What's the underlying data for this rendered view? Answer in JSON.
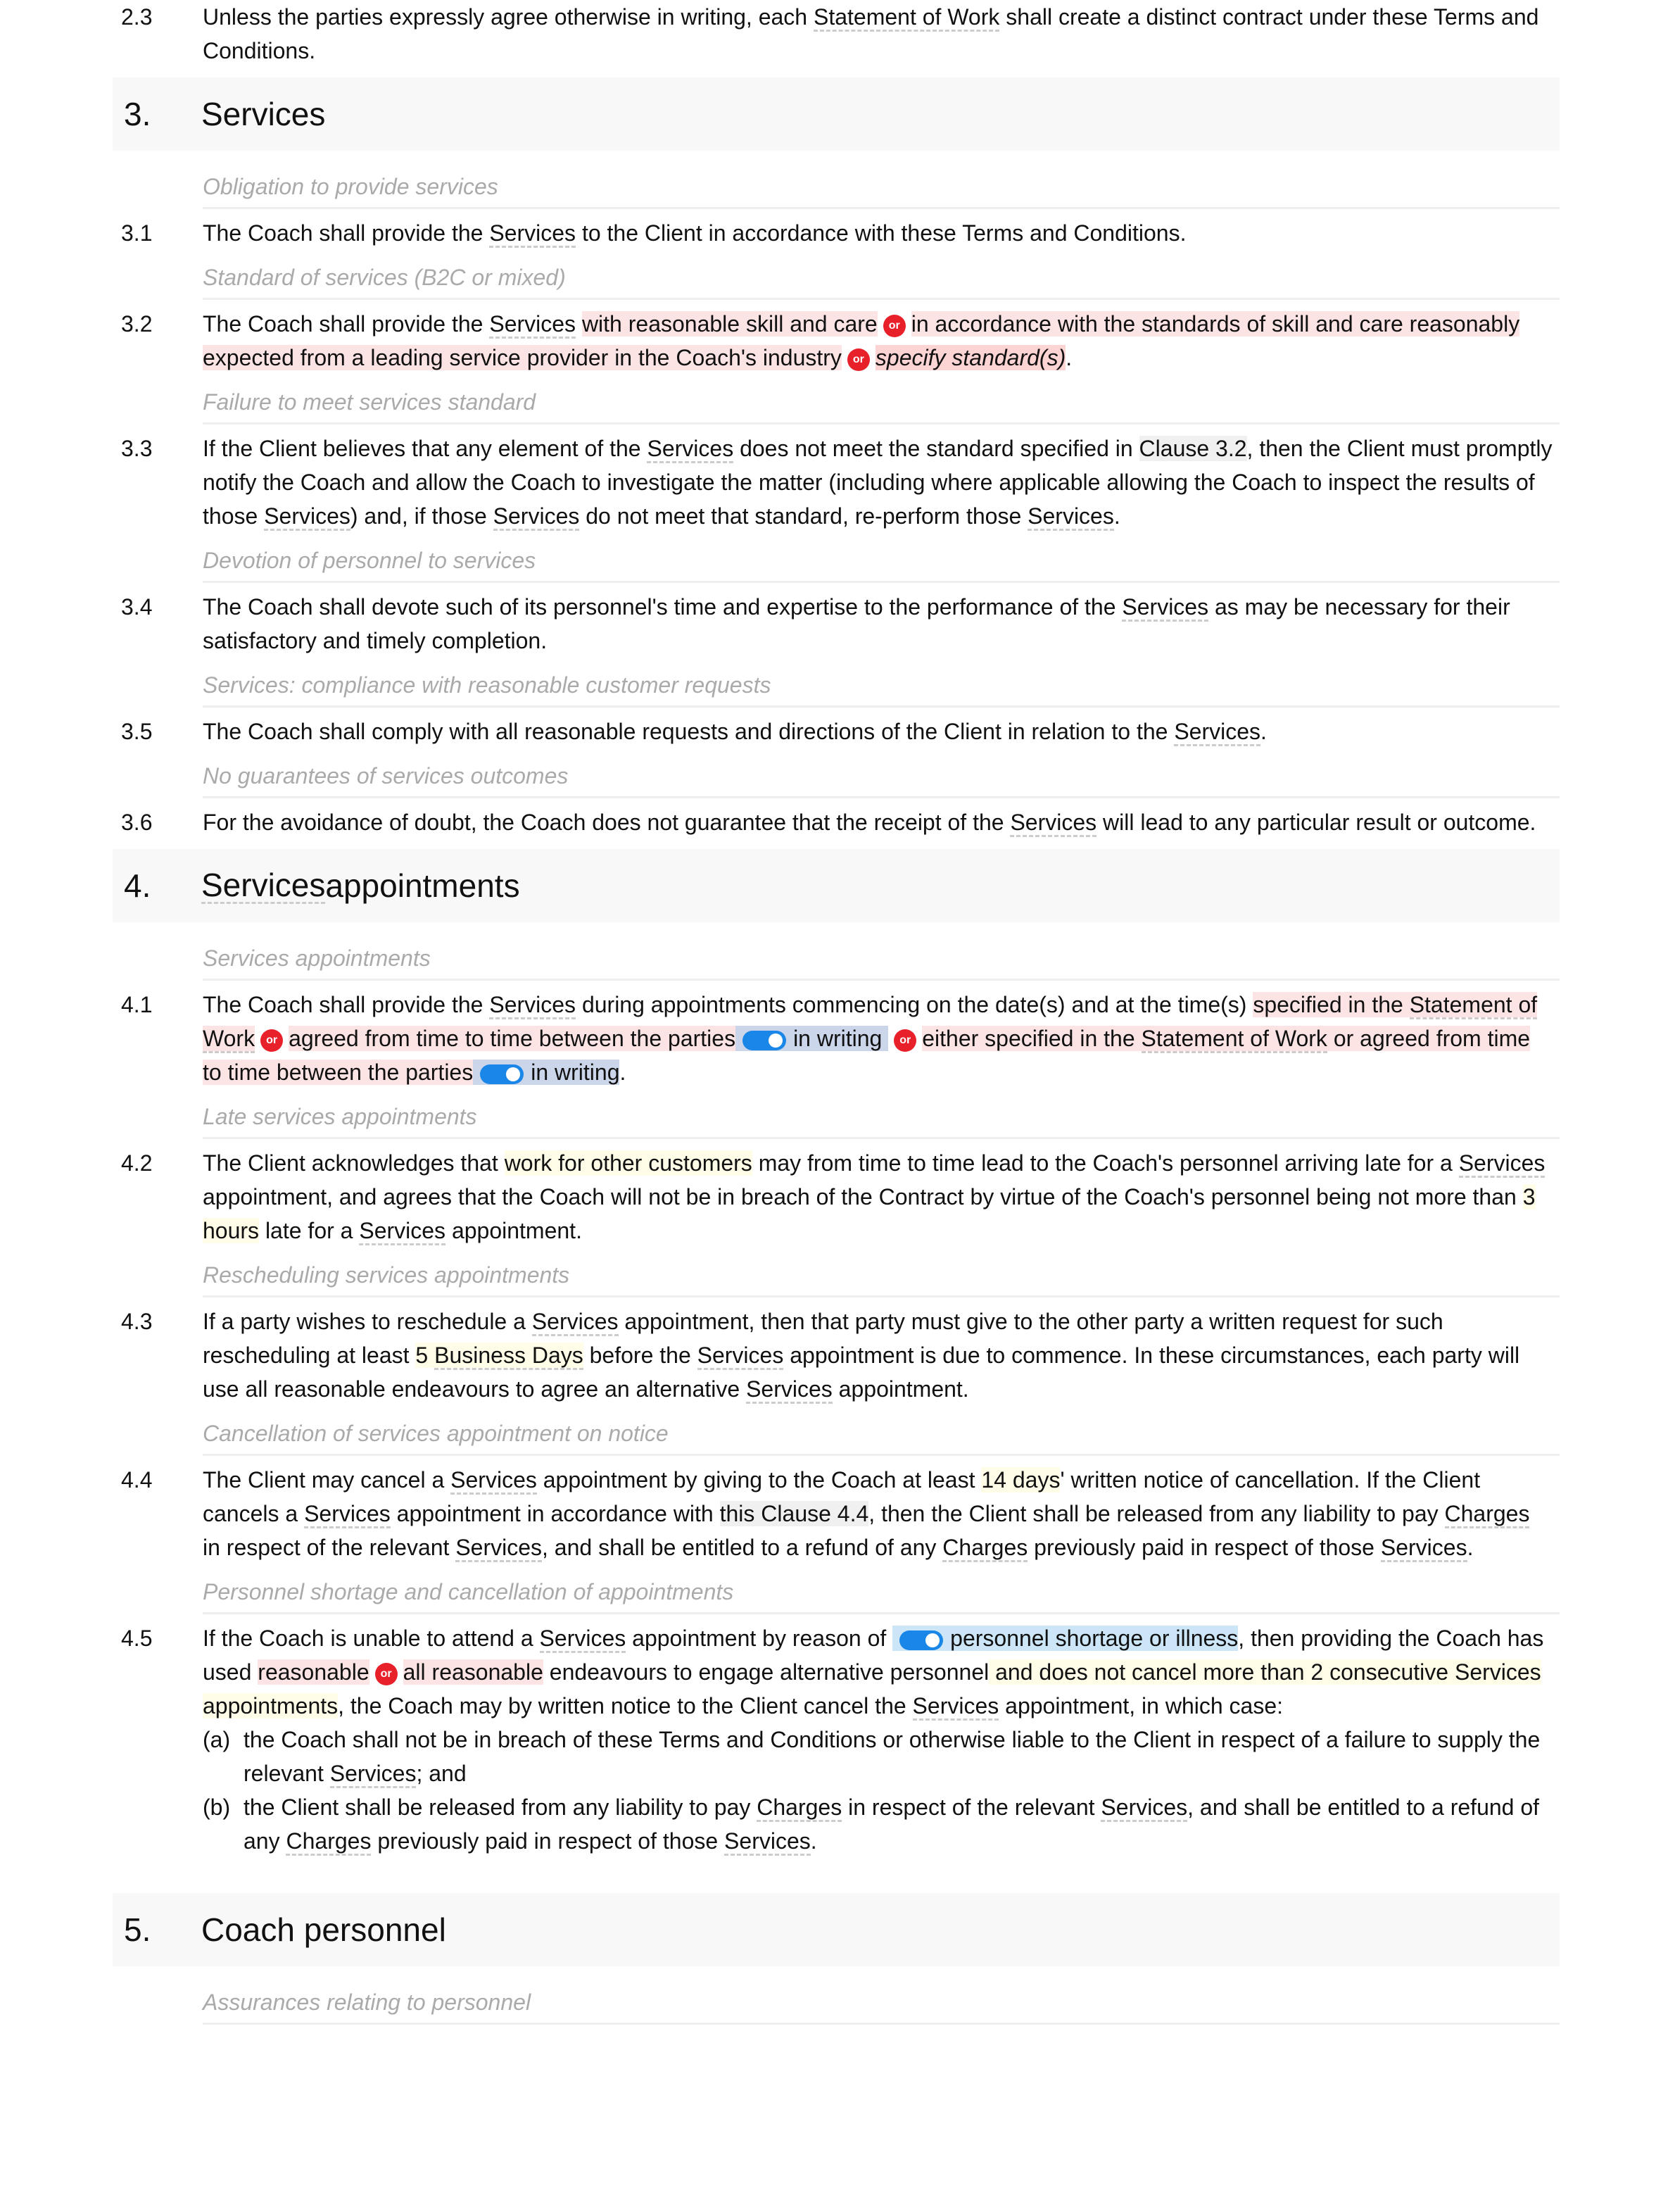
{
  "c23": {
    "num": "2.3",
    "t1": "Unless the parties expressly agree otherwise in writing, each ",
    "d1": "Statement of Work",
    "t2": " shall create a distinct contract under these Terms and Conditions."
  },
  "s3": {
    "num": "3.",
    "title": "Services"
  },
  "n31": "Obligation to provide services",
  "c31": {
    "num": "3.1",
    "t1": "The Coach shall provide the ",
    "d1": "Services",
    "t2": " to the Client in accordance with these Terms and Conditions."
  },
  "n32": "Standard of services (B2C or mixed)",
  "c32": {
    "num": "3.2",
    "t1": "The Coach shall provide the ",
    "d1": "Services",
    "o1": "with reasonable skill and care",
    "o2": "in accordance with the standards of skill and care reasonably expected from a leading service provider in the Coach's industry",
    "o3": "specify standard(s)",
    "end": "."
  },
  "n33": "Failure to meet services standard",
  "c33": {
    "num": "3.3",
    "t1": "If the Client believes that any element of the ",
    "d1": "Services",
    "t2": " does not meet the standard specified in ",
    "ref": "Clause 3.2",
    "t3": ", then the Client must promptly notify the Coach and allow the Coach to investigate the matter (including where applicable allowing the Coach to inspect the results of those ",
    "t4": ") and, if those ",
    "t5": " do not meet that standard, re-perform those ",
    "end": "."
  },
  "n34": "Devotion of personnel to services",
  "c34": {
    "num": "3.4",
    "t1": "The Coach shall devote such of its personnel's time and expertise to the performance of the ",
    "d1": "Services",
    "t2": " as may be necessary for their satisfactory and timely completion."
  },
  "n35": "Services: compliance with reasonable customer requests",
  "c35": {
    "num": "3.5",
    "t1": "The Coach shall comply with all reasonable requests and directions of the Client in relation to the ",
    "d1": "Services",
    "end": "."
  },
  "n36": "No guarantees of services outcomes",
  "c36": {
    "num": "3.6",
    "t1": "For the avoidance of doubt, the Coach does not guarantee that the receipt of the ",
    "d1": "Services",
    "t2": " will lead to any particular result or outcome."
  },
  "s4": {
    "num": "4.",
    "title_d": "Services",
    "title": " appointments"
  },
  "n41": "Services appointments",
  "c41": {
    "num": "4.1",
    "t1": "The Coach shall provide the ",
    "d1": "Services",
    "t2": " during appointments commencing on the date(s) and at the time(s) ",
    "o1a": "specified in the ",
    "o1d": "Statement of Work",
    "o2": "agreed from time to time between the parties",
    "w": "in writing",
    "o3a": "either specified in the ",
    "o3d": "Statement of Work",
    "o3b": " or agreed from time to time between the parties",
    "end": "."
  },
  "n42": "Late services appointments",
  "c42": {
    "num": "4.2",
    "t1": "The Client acknowledges that ",
    "y1": "work for other customers",
    "t2": " may from time to time lead to the Coach's personnel arriving late for a ",
    "d1": "Services",
    "t3": " appointment, and agrees that the Coach will not be in breach of the Contract by virtue of the Coach's personnel being not more than ",
    "y2": "3 hours",
    "t4": " late for a ",
    "t5": " appointment."
  },
  "n43": "Rescheduling services appointments",
  "c43": {
    "num": "4.3",
    "t1": "If a party wishes to reschedule a ",
    "d1": "Services",
    "t2": " appointment, then that party must give to the other party a written request for such rescheduling at least ",
    "y1": "5 ",
    "d2": "Business Days",
    "t3": " before the ",
    "t4": " appointment is due to commence. In these circumstances, each party will use all reasonable endeavours to agree an alternative ",
    "t5": " appointment."
  },
  "n44": "Cancellation of services appointment on notice",
  "c44": {
    "num": "4.4",
    "t1": "The Client may cancel a ",
    "d1": "Services",
    "t2": " appointment by giving to the Coach at least ",
    "y1": "14 days",
    "t3": "' written notice of cancellation. If the Client cancels a ",
    "t4": " appointment in accordance with ",
    "ref": "this Clause 4.4",
    "t5": ", then the Client shall be released from any liability to pay ",
    "d2": "Charges",
    "t6": " in respect of the relevant ",
    "t7": ", and shall be entitled to a refund of any ",
    "t8": " previously paid in respect of those ",
    "end": "."
  },
  "n45": "Personnel shortage and cancellation of appointments",
  "c45": {
    "num": "4.5",
    "t1": "If the Coach is unable to attend a ",
    "d1": "Services",
    "t2": " appointment by reason of ",
    "b1": "personnel shortage or illness",
    "t3": ", then providing the Coach has used ",
    "o1": "reasonable",
    "o2": "all reasonable",
    "t4": " endeavours to engage alternative personnel",
    "y1": " and does not cancel more than 2 consecutive Services appointments",
    "t5": ", the Coach may by written notice to the Client cancel the ",
    "t6": " appointment, in which case:",
    "a": {
      "l": "(a)",
      "t1": "the Coach shall not be in breach of these Terms and Conditions or otherwise liable to the Client in respect of a failure to supply the relevant ",
      "t2": "; and"
    },
    "b": {
      "l": "(b)",
      "t1": "the Client shall be released from any liability to pay ",
      "d2": "Charges",
      "t2": " in respect of the relevant ",
      "t3": ", and shall be entitled to a refund of any ",
      "t4": " previously paid in respect of those ",
      "end": "."
    }
  },
  "s5": {
    "num": "5.",
    "title": "Coach personnel"
  },
  "n51": "Assurances relating to personnel",
  "or_label": "or"
}
